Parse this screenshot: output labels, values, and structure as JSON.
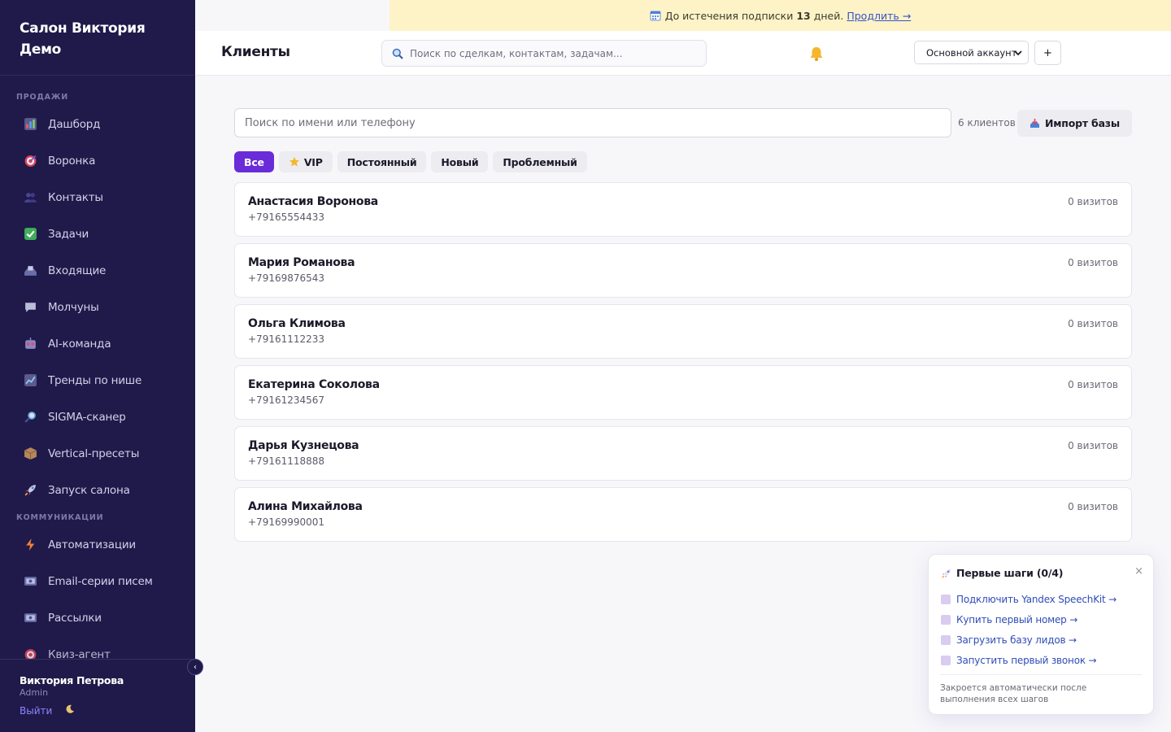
{
  "sidebar": {
    "brand": "Салон Виктория Демо",
    "sections": [
      {
        "label": "ПРОДАЖИ"
      },
      {
        "label": "КОММУНИКАЦИИ"
      }
    ],
    "items": [
      {
        "label": "Дашборд",
        "icon": "bar-chart-icon"
      },
      {
        "label": "Воронка",
        "icon": "target-icon"
      },
      {
        "label": "Контакты",
        "icon": "people-icon"
      },
      {
        "label": "Задачи",
        "icon": "check-box-icon"
      },
      {
        "label": "Входящие",
        "icon": "inbox-tray-icon"
      },
      {
        "label": "Молчуны",
        "icon": "speech-bubble-icon"
      },
      {
        "label": "AI-команда",
        "icon": "robot-icon"
      },
      {
        "label": "Тренды по нише",
        "icon": "trend-chart-icon"
      },
      {
        "label": "SIGMA-сканер",
        "icon": "magnifier-icon"
      },
      {
        "label": "Vertical-пресеты",
        "icon": "package-icon"
      },
      {
        "label": "Запуск салона",
        "icon": "rocket-icon"
      },
      {
        "label": "Автоматизации",
        "icon": "lightning-icon"
      },
      {
        "label": "Email-серии писем",
        "icon": "envelope-icon"
      },
      {
        "label": "Рассылки",
        "icon": "envelope-icon"
      },
      {
        "label": "Квиз-агент",
        "icon": "target-icon"
      }
    ],
    "user": {
      "name": "Виктория Петрова",
      "role": "Admin",
      "logout": "Выйти"
    },
    "collapse": "‹"
  },
  "banner": {
    "text_before": "До истечения подписки",
    "days": "13",
    "text_after": "дней.",
    "link": "Продлить →"
  },
  "header": {
    "title": "Клиенты",
    "search_placeholder": "Поиск по сделкам, контактам, задачам...",
    "account": "Основной аккаунт",
    "plus": "+"
  },
  "main": {
    "search_placeholder": "Поиск по имени или телефону",
    "count": "6 клиентов",
    "import": "Импорт базы",
    "filters": [
      {
        "label": "Все",
        "active": true
      },
      {
        "label": "VIP",
        "active": false
      },
      {
        "label": "Постоянный",
        "active": false
      },
      {
        "label": "Новый",
        "active": false
      },
      {
        "label": "Проблемный",
        "active": false
      }
    ],
    "clients": [
      {
        "name": "Анастасия Воронова",
        "phone": "+79165554433",
        "visits": "0 визитов"
      },
      {
        "name": "Мария Романова",
        "phone": "+79169876543",
        "visits": "0 визитов"
      },
      {
        "name": "Ольга Климова",
        "phone": "+79161112233",
        "visits": "0 визитов"
      },
      {
        "name": "Екатерина Соколова",
        "phone": "+79161234567",
        "visits": "0 визитов"
      },
      {
        "name": "Дарья Кузнецова",
        "phone": "+79161118888",
        "visits": "0 визитов"
      },
      {
        "name": "Алина Михайлова",
        "phone": "+79169990001",
        "visits": "0 визитов"
      }
    ]
  },
  "onboarding": {
    "title": "Первые шаги (0/4)",
    "close": "×",
    "steps": [
      "Подключить Yandex SpeechKit →",
      "Купить первый номер →",
      "Загрузить базу лидов →",
      "Запустить первый звонок →"
    ],
    "footer": "Закроется автоматически после выполнения всех шагов"
  },
  "colors": {
    "sidebar_bg": "#1f1a4a",
    "accent": "#6a2bd9",
    "banner_bg": "#fdf3c7",
    "link": "#3551c9"
  }
}
